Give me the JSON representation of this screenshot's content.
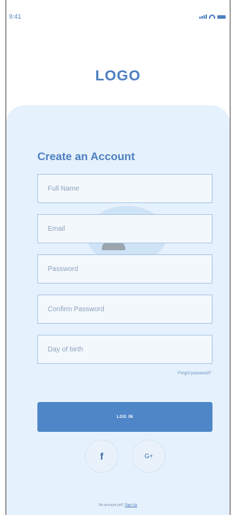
{
  "status_bar": {
    "time": "9:41",
    "icons": [
      "signal-icon",
      "wifi-icon",
      "battery-icon"
    ]
  },
  "logo": "LOGO",
  "form": {
    "title": "Create an Account",
    "fields": {
      "full_name": {
        "placeholder": "Full Name",
        "value": ""
      },
      "email": {
        "placeholder": "Email",
        "value": ""
      },
      "password": {
        "placeholder": "Password",
        "value": ""
      },
      "confirm_password": {
        "placeholder": "Confirm Password",
        "value": ""
      },
      "dob": {
        "placeholder": "Day of birth",
        "value": ""
      }
    },
    "forgot_password": "Forgot password?",
    "login_button": "LOG IN"
  },
  "social": {
    "facebook_label": "f",
    "google_label": "G+"
  },
  "footer": {
    "prompt": "No account yet?",
    "signup_link": "Sign Up"
  },
  "colors": {
    "accent": "#4d7fc0",
    "card_background": "#e5f1fc",
    "field_border": "#a8c6e6",
    "button": "#4f86c8"
  }
}
